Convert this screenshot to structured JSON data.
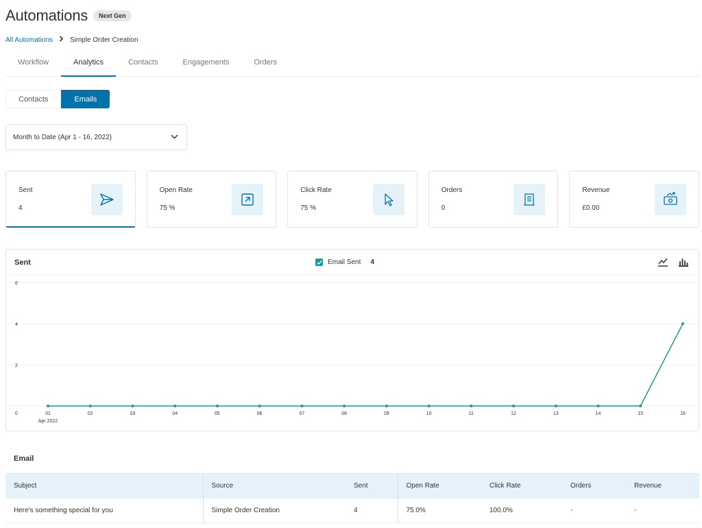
{
  "header": {
    "title": "Automations",
    "badge": "Next Gen"
  },
  "breadcrumb": {
    "link": "All Automations",
    "current": "Simple Order Creation"
  },
  "tabs": [
    {
      "label": "Workflow",
      "active": false
    },
    {
      "label": "Analytics",
      "active": true
    },
    {
      "label": "Contacts",
      "active": false
    },
    {
      "label": "Engagements",
      "active": false
    },
    {
      "label": "Orders",
      "active": false
    }
  ],
  "segment": {
    "contacts": "Contacts",
    "emails": "Emails",
    "active": "Emails"
  },
  "date_filter": {
    "value": "Month to Date (Apr 1 - 16, 2022)"
  },
  "cards": [
    {
      "label": "Sent",
      "value": "4",
      "icon": "send-icon",
      "active": true
    },
    {
      "label": "Open Rate",
      "value": "75 %",
      "icon": "open-mail-icon",
      "active": false
    },
    {
      "label": "Click Rate",
      "value": "75 %",
      "icon": "cursor-icon",
      "active": false
    },
    {
      "label": "Orders",
      "value": "0",
      "icon": "receipt-icon",
      "active": false
    },
    {
      "label": "Revenue",
      "value": "£0.00",
      "icon": "money-icon",
      "active": false
    }
  ],
  "chart": {
    "title": "Sent",
    "legend_label": "Email Sent",
    "legend_count": "4"
  },
  "chart_data": {
    "type": "line",
    "title": "Sent",
    "x": [
      "01",
      "02",
      "03",
      "04",
      "05",
      "06",
      "07",
      "08",
      "09",
      "10",
      "11",
      "12",
      "13",
      "14",
      "15",
      "16"
    ],
    "x_sublabel": "Apr 2022",
    "series": [
      {
        "name": "Email Sent",
        "values": [
          0,
          0,
          0,
          0,
          0,
          0,
          0,
          0,
          0,
          0,
          0,
          0,
          0,
          0,
          0,
          4
        ]
      }
    ],
    "yticks": [
      0,
      2,
      4,
      6
    ],
    "ylim": [
      0,
      6
    ],
    "grid": true,
    "colors": {
      "line": "#1a9a9a",
      "grid": "#ececec"
    }
  },
  "email_section": {
    "title": "Email",
    "columns": [
      "Subject",
      "Source",
      "Sent",
      "Open Rate",
      "Click Rate",
      "Orders",
      "Revenue"
    ],
    "rows": [
      [
        "Here's something special for you",
        "Simple Order Creation",
        "4",
        "75.0%",
        "100.0%",
        "-",
        "-"
      ]
    ]
  },
  "colors": {
    "accent": "#0073aa",
    "icon_bg": "#e6f2fa",
    "series": "#1a9a9a"
  }
}
